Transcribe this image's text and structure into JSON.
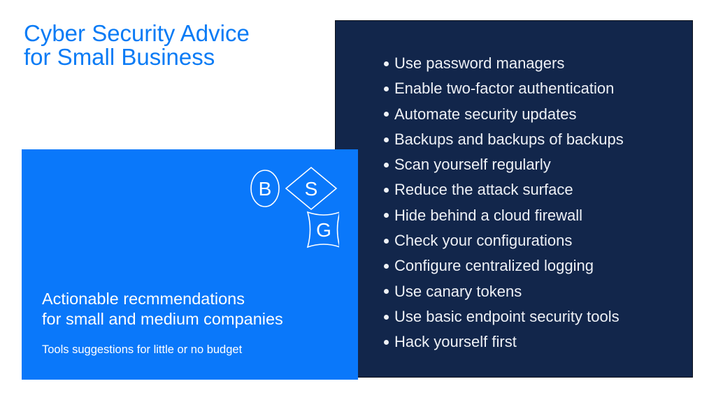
{
  "title": {
    "line1": "Cyber Security Advice",
    "line2": "for Small Business"
  },
  "logo": {
    "letters": [
      "B",
      "S",
      "G"
    ],
    "icon": "bsg-logo-icon"
  },
  "subtitle": {
    "line1": "Actionable recmmendations",
    "line2": "for small and medium companies"
  },
  "tagline": "Tools suggestions for little or no budget",
  "advice_list": [
    "Use password managers",
    "Enable two-factor authentication",
    "Automate security updates",
    "Backups and backups of backups",
    "Scan yourself regularly",
    "Reduce the attack surface",
    "Hide behind a cloud firewall",
    "Check your configurations",
    "Configure centralized logging",
    "Use canary tokens",
    "Use basic endpoint security tools",
    "Hack yourself first"
  ],
  "colors": {
    "title_blue": "#0a7bf5",
    "panel_blue": "#0a78fa",
    "panel_navy": "#12264b",
    "text_white": "#ffffff"
  }
}
